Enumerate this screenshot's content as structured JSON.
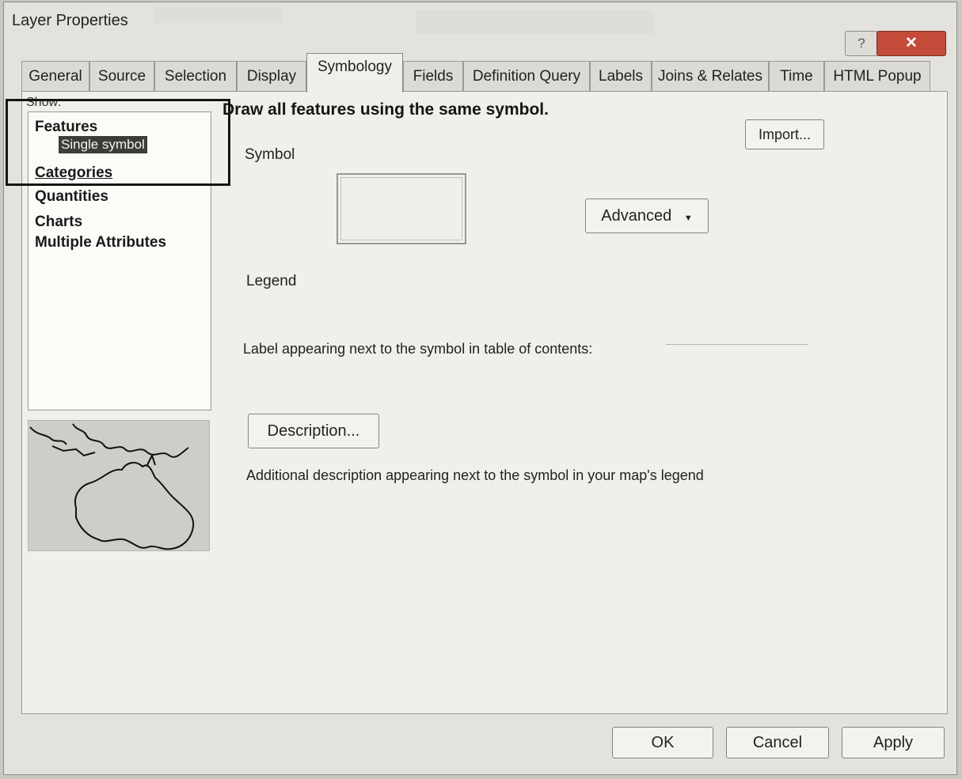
{
  "window": {
    "title": "Layer Properties"
  },
  "titlebar": {
    "help": "?",
    "close": "✕"
  },
  "tabs": [
    {
      "label": "General"
    },
    {
      "label": "Source"
    },
    {
      "label": "Selection"
    },
    {
      "label": "Display"
    },
    {
      "label": "Symbology"
    },
    {
      "label": "Fields"
    },
    {
      "label": "Definition Query"
    },
    {
      "label": "Labels"
    },
    {
      "label": "Joins & Relates"
    },
    {
      "label": "Time"
    },
    {
      "label": "HTML Popup"
    }
  ],
  "active_tab": "Symbology",
  "show": {
    "label": "Show:",
    "features": "Features",
    "single_symbol": "Single symbol",
    "categories": "Categories",
    "quantities": "Quantities",
    "charts": "Charts",
    "multiple_attributes": "Multiple Attributes"
  },
  "symbology": {
    "heading": "Draw all features using the same symbol.",
    "import_label": "Import...",
    "symbol_label": "Symbol",
    "advanced_label": "Advanced",
    "legend_label": "Legend",
    "toc_label_text": "Label appearing next to the symbol in table of contents:",
    "description_button": "Description...",
    "description_text": "Additional description appearing next to the symbol in your map's legend"
  },
  "footer": {
    "ok": "OK",
    "cancel": "Cancel",
    "apply": "Apply"
  }
}
